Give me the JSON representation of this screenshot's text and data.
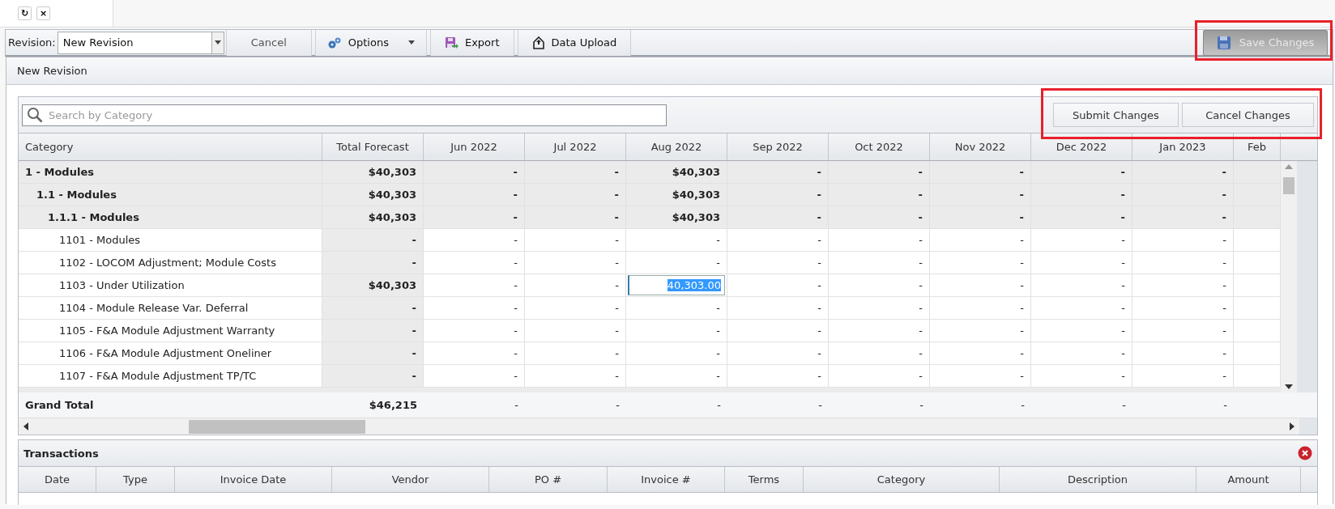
{
  "tab_buttons": [
    {
      "label": "↻"
    },
    {
      "label": "×"
    }
  ],
  "toolbar": {
    "revision_label": "Revision:",
    "revision_value": "New Revision",
    "buttons": [
      {
        "label": "Cancel",
        "kind": "plain"
      },
      {
        "label": "Options",
        "kind": "menu"
      },
      {
        "label": "Export",
        "kind": "export"
      },
      {
        "label": "Data Upload",
        "kind": "upload"
      }
    ],
    "save_button": {
      "label": "Save Changes",
      "disabled": true
    }
  },
  "panel": {
    "title": "New Revision"
  },
  "grid": {
    "search_placeholder": "Search by Category",
    "actions": [
      "Submit Changes",
      "Cancel Changes"
    ],
    "columns": [
      "Category",
      "Total Forecast",
      "Jun 2022",
      "Jul 2022",
      "Aug 2022",
      "Sep 2022",
      "Oct 2022",
      "Nov 2022",
      "Dec 2022",
      "Jan 2023",
      "Feb"
    ],
    "rows": [
      {
        "cells": [
          "1 - Modules",
          "$40,303",
          "-",
          "-",
          "$40,303",
          "-",
          "-",
          "-",
          "-",
          "-"
        ],
        "children": [
          {
            "cells": [
              "1.1 - Modules",
              "$40,303",
              "-",
              "-",
              "$40,303",
              "-",
              "-",
              "-",
              "-",
              "-"
            ],
            "children": [
              {
                "cells": [
                  "1.1.1 - Modules",
                  "$40,303",
                  "-",
                  "-",
                  "$40,303",
                  "-",
                  "-",
                  "-",
                  "-",
                  "-"
                ],
                "children": [
                  {
                    "cells": [
                      "1101 - Modules",
                      "-",
                      "-",
                      "-",
                      "-",
                      "-",
                      "-",
                      "-",
                      "-",
                      "-"
                    ]
                  },
                  {
                    "cells": [
                      "1102 - LOCOM Adjustment; Module Costs",
                      "-",
                      "-",
                      "-",
                      "-",
                      "-",
                      "-",
                      "-",
                      "-",
                      "-"
                    ]
                  },
                  {
                    "cells": [
                      {
                        "value": "1103 - Under Utilization",
                        "editing": false
                      },
                      {
                        "value": "$40,303",
                        "editing": false
                      },
                      {
                        "value": "-",
                        "editing": false
                      },
                      {
                        "value": "-",
                        "editing": false
                      },
                      {
                        "value": "40,303.00",
                        "editing": true
                      },
                      {
                        "value": "-",
                        "editing": false
                      },
                      {
                        "value": "-",
                        "editing": false
                      },
                      {
                        "value": "-",
                        "editing": false
                      },
                      {
                        "value": "-",
                        "editing": false
                      },
                      {
                        "value": "-",
                        "editing": false
                      }
                    ]
                  },
                  {
                    "cells": [
                      "1104 - Module Release Var. Deferral",
                      "-",
                      "-",
                      "-",
                      "-",
                      "-",
                      "-",
                      "-",
                      "-",
                      "-"
                    ]
                  },
                  {
                    "cells": [
                      "1105 - F&A Module Adjustment Warranty",
                      "-",
                      "-",
                      "-",
                      "-",
                      "-",
                      "-",
                      "-",
                      "-",
                      "-"
                    ]
                  },
                  {
                    "cells": [
                      "1106 - F&A Module Adjustment Oneliner",
                      "-",
                      "-",
                      "-",
                      "-",
                      "-",
                      "-",
                      "-",
                      "-",
                      "-"
                    ]
                  },
                  {
                    "cells": [
                      "1107 - F&A Module Adjustment TP/TC",
                      "-",
                      "-",
                      "-",
                      "-",
                      "-",
                      "-",
                      "-",
                      "-",
                      "-"
                    ]
                  }
                ]
              }
            ]
          }
        ]
      }
    ],
    "grand_total": {
      "cells": [
        "Grand Total",
        "$46,215",
        "-",
        "-",
        "-",
        "-",
        "-",
        "-",
        "-",
        "-"
      ]
    }
  },
  "transactions": {
    "title": "Transactions",
    "columns": [
      "Date",
      "Type",
      "Invoice Date",
      "Vendor",
      "PO #",
      "Invoice #",
      "Terms",
      "Category",
      "Description",
      "Amount"
    ]
  }
}
